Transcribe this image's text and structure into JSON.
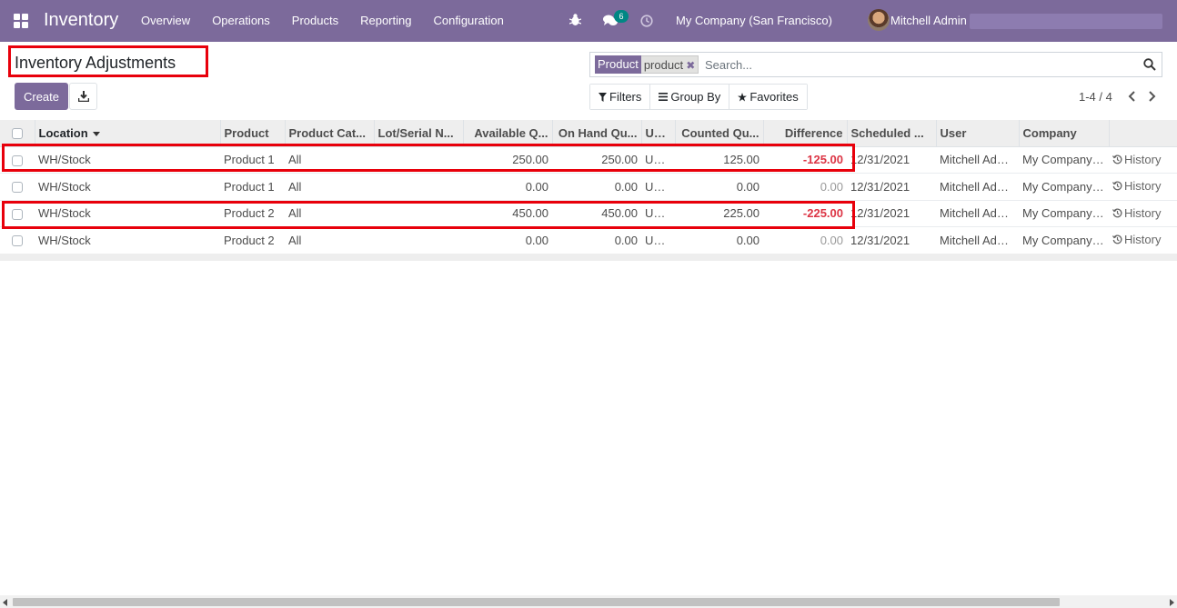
{
  "navbar": {
    "app_title": "Inventory",
    "menu": [
      "Overview",
      "Operations",
      "Products",
      "Reporting",
      "Configuration"
    ],
    "chat_badge": "6",
    "company": "My Company (San Francisco)",
    "user": "Mitchell Admin",
    "color": "#7c6a9b"
  },
  "control": {
    "title": "Inventory Adjustments",
    "create_label": "Create",
    "search": {
      "facet_label": "Product",
      "facet_value": "product",
      "placeholder": "Search..."
    },
    "filters_label": "Filters",
    "groupby_label": "Group By",
    "favorites_label": "Favorites",
    "pager": "1-4 / 4"
  },
  "table": {
    "columns": [
      "Location",
      "Product",
      "Product Cat...",
      "Lot/Serial N...",
      "Available Q...",
      "On Hand Qu...",
      "UoM",
      "Counted Qu...",
      "Difference",
      "Scheduled ...",
      "User",
      "Company"
    ],
    "history_label": "History",
    "rows": [
      {
        "location": "WH/Stock",
        "product": "Product 1",
        "category": "All",
        "lot": "",
        "available": "250.00",
        "onhand": "250.00",
        "uom": "Units",
        "counted": "125.00",
        "difference": "-125.00",
        "scheduled": "12/31/2021",
        "user": "Mitchell Admin",
        "company": "My Company (San Francisco)"
      },
      {
        "location": "WH/Stock",
        "product": "Product 1",
        "category": "All",
        "lot": "",
        "available": "0.00",
        "onhand": "0.00",
        "uom": "Units",
        "counted": "0.00",
        "difference": "0.00",
        "scheduled": "12/31/2021",
        "user": "Mitchell Admin",
        "company": "My Company (San Francisco)"
      },
      {
        "location": "WH/Stock",
        "product": "Product 2",
        "category": "All",
        "lot": "",
        "available": "450.00",
        "onhand": "450.00",
        "uom": "Units",
        "counted": "225.00",
        "difference": "-225.00",
        "scheduled": "12/31/2021",
        "user": "Mitchell Admin",
        "company": "My Company (San Francisco)"
      },
      {
        "location": "WH/Stock",
        "product": "Product 2",
        "category": "All",
        "lot": "",
        "available": "0.00",
        "onhand": "0.00",
        "uom": "Units",
        "counted": "0.00",
        "difference": "0.00",
        "scheduled": "12/31/2021",
        "user": "Mitchell Admin",
        "company": "My Company (San Francisco)"
      }
    ]
  },
  "colors": {
    "accent": "#7c6a9b",
    "highlight": "#e8000b",
    "negative": "#dc3545"
  }
}
